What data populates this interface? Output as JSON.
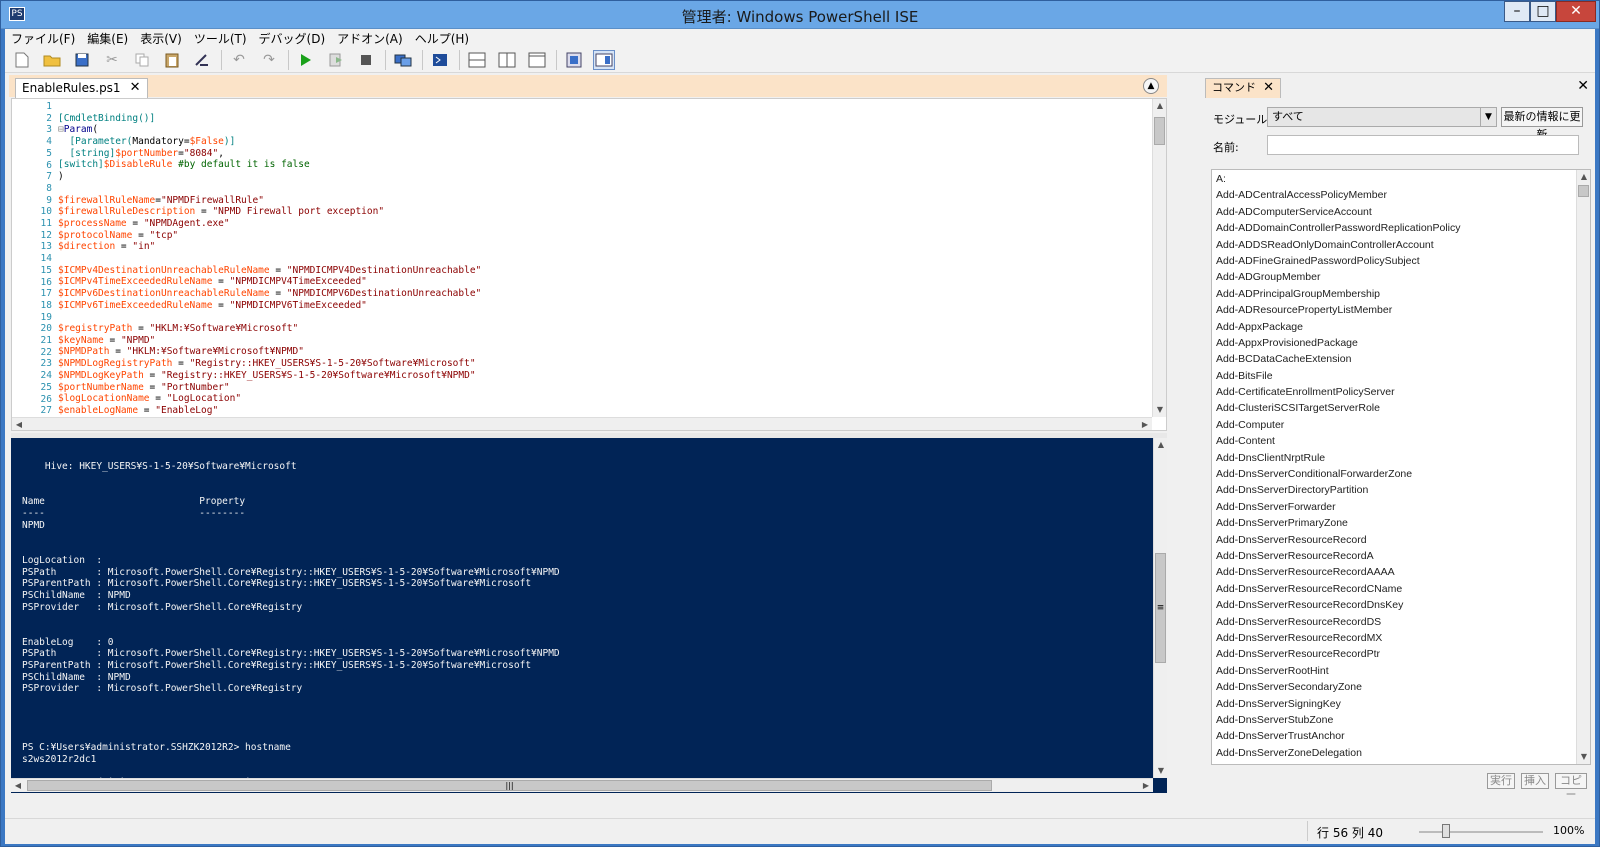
{
  "window": {
    "title": "管理者: Windows PowerShell ISE",
    "icon_glyph": "PS",
    "min": "–",
    "max": "□",
    "close": "✕"
  },
  "menus": [
    "ファイル(F)",
    "編集(E)",
    "表示(V)",
    "ツール(T)",
    "デバッグ(D)",
    "アドオン(A)",
    "ヘルプ(H)"
  ],
  "toolbar": {
    "icons": [
      "new-file-icon",
      "open-folder-icon",
      "save-icon",
      "cut-icon",
      "copy-icon",
      "paste-icon",
      "clear-icon",
      "undo-icon",
      "redo-icon",
      "run-icon",
      "run-selection-icon",
      "stop-icon",
      "remote-icon",
      "powershell-icon",
      "layout-top-icon",
      "layout-right-icon",
      "layout-max-icon",
      "show-commands-icon",
      "show-addon-icon"
    ],
    "colors": {
      "run": "#1aa11a",
      "stop": "#555555"
    }
  },
  "editor": {
    "tab": "EnableRules.ps1",
    "tab_close": "✕",
    "collapse_glyph": "▲",
    "lines": [
      [],
      [
        [
          "t",
          "[CmdletBinding()]"
        ]
      ],
      [
        [
          "fold",
          "⊟"
        ],
        [
          "k",
          "Param"
        ],
        [
          "",
          "("
        ]
      ],
      [
        [
          "",
          "  "
        ],
        [
          "t",
          "[Parameter("
        ],
        [
          "",
          "Mandatory="
        ],
        [
          "v",
          "$False"
        ],
        [
          "t",
          ")]"
        ]
      ],
      [
        [
          "",
          "  "
        ],
        [
          "t",
          "[string]"
        ],
        [
          "v",
          "$portNumber"
        ],
        [
          "",
          "="
        ],
        [
          "s",
          "\"8084\""
        ],
        [
          "",
          ","
        ]
      ],
      [
        [
          "t",
          "[switch]"
        ],
        [
          "v",
          "$DisableRule"
        ],
        [
          "",
          " "
        ],
        [
          "c",
          "#by default it is false"
        ]
      ],
      [
        [
          "",
          ")"
        ]
      ],
      [],
      [
        [
          "v",
          "$firewallRuleName"
        ],
        [
          "",
          "="
        ],
        [
          "s",
          "\"NPMDFirewallRule\""
        ]
      ],
      [
        [
          "v",
          "$firewallRuleDescription"
        ],
        [
          "",
          " = "
        ],
        [
          "s",
          "\"NPMD Firewall port exception\""
        ]
      ],
      [
        [
          "v",
          "$processName"
        ],
        [
          "",
          " = "
        ],
        [
          "s",
          "\"NPMDAgent.exe\""
        ]
      ],
      [
        [
          "v",
          "$protocolName"
        ],
        [
          "",
          " = "
        ],
        [
          "s",
          "\"tcp\""
        ]
      ],
      [
        [
          "v",
          "$direction"
        ],
        [
          "",
          " = "
        ],
        [
          "s",
          "\"in\""
        ]
      ],
      [],
      [
        [
          "v",
          "$ICMPv4DestinationUnreachableRuleName"
        ],
        [
          "",
          " = "
        ],
        [
          "s",
          "\"NPMDICMPV4DestinationUnreachable\""
        ]
      ],
      [
        [
          "v",
          "$ICMPv4TimeExceededRuleName"
        ],
        [
          "",
          " = "
        ],
        [
          "s",
          "\"NPMDICMPV4TimeExceeded\""
        ]
      ],
      [
        [
          "v",
          "$ICMPv6DestinationUnreachableRuleName"
        ],
        [
          "",
          " = "
        ],
        [
          "s",
          "\"NPMDICMPV6DestinationUnreachable\""
        ]
      ],
      [
        [
          "v",
          "$ICMPv6TimeExceededRuleName"
        ],
        [
          "",
          " = "
        ],
        [
          "s",
          "\"NPMDICMPV6TimeExceeded\""
        ]
      ],
      [],
      [
        [
          "v",
          "$registryPath"
        ],
        [
          "",
          " = "
        ],
        [
          "s",
          "\"HKLM:¥Software¥Microsoft\""
        ]
      ],
      [
        [
          "v",
          "$keyName"
        ],
        [
          "",
          " = "
        ],
        [
          "s",
          "\"NPMD\""
        ]
      ],
      [
        [
          "v",
          "$NPMDPath"
        ],
        [
          "",
          " = "
        ],
        [
          "s",
          "\"HKLM:¥Software¥Microsoft¥NPMD\""
        ]
      ],
      [
        [
          "v",
          "$NPMDLogRegistryPath"
        ],
        [
          "",
          " = "
        ],
        [
          "s",
          "\"Registry::HKEY_USERS¥S-1-5-20¥Software¥Microsoft\""
        ]
      ],
      [
        [
          "v",
          "$NPMDLogKeyPath"
        ],
        [
          "",
          " = "
        ],
        [
          "s",
          "\"Registry::HKEY_USERS¥S-1-5-20¥Software¥Microsoft¥NPMD\""
        ]
      ],
      [
        [
          "v",
          "$portNumberName"
        ],
        [
          "",
          " = "
        ],
        [
          "s",
          "\"PortNumber\""
        ]
      ],
      [
        [
          "v",
          "$logLocationName"
        ],
        [
          "",
          " = "
        ],
        [
          "s",
          "\"LogLocation\""
        ]
      ],
      [
        [
          "v",
          "$enableLogName"
        ],
        [
          "",
          " = "
        ],
        [
          "s",
          "\"EnableLog\""
        ]
      ]
    ]
  },
  "console": {
    "lines": [
      "",
      "",
      "    Hive: HKEY_USERS¥S-1-5-20¥Software¥Microsoft",
      "",
      "",
      "Name                           Property",
      "----                           --------",
      "NPMD",
      "",
      "",
      "LogLocation  :",
      "PSPath       : Microsoft.PowerShell.Core¥Registry::HKEY_USERS¥S-1-5-20¥Software¥Microsoft¥NPMD",
      "PSParentPath : Microsoft.PowerShell.Core¥Registry::HKEY_USERS¥S-1-5-20¥Software¥Microsoft",
      "PSChildName  : NPMD",
      "PSProvider   : Microsoft.PowerShell.Core¥Registry",
      "",
      "",
      "EnableLog    : 0",
      "PSPath       : Microsoft.PowerShell.Core¥Registry::HKEY_USERS¥S-1-5-20¥Software¥Microsoft¥NPMD",
      "PSParentPath : Microsoft.PowerShell.Core¥Registry::HKEY_USERS¥S-1-5-20¥Software¥Microsoft",
      "PSChildName  : NPMD",
      "PSProvider   : Microsoft.PowerShell.Core¥Registry",
      "",
      "",
      "",
      "",
      "PS C:¥Users¥administrator.SSHZK2012R2> hostname",
      "s2ws2012r2dc1",
      "",
      "PS C:¥Users¥administrator.SSHZK2012R2> |"
    ]
  },
  "commands": {
    "tab": "コマンド",
    "tab_close": "✕",
    "pane_close": "✕",
    "module_label": "モジュール:",
    "module_value": "すべて",
    "refresh_button": "最新の情報に更新",
    "name_label": "名前:",
    "name_value": "",
    "items": [
      "A:",
      "Add-ADCentralAccessPolicyMember",
      "Add-ADComputerServiceAccount",
      "Add-ADDomainControllerPasswordReplicationPolicy",
      "Add-ADDSReadOnlyDomainControllerAccount",
      "Add-ADFineGrainedPasswordPolicySubject",
      "Add-ADGroupMember",
      "Add-ADPrincipalGroupMembership",
      "Add-ADResourcePropertyListMember",
      "Add-AppxPackage",
      "Add-AppxProvisionedPackage",
      "Add-BCDataCacheExtension",
      "Add-BitsFile",
      "Add-CertificateEnrollmentPolicyServer",
      "Add-ClusteriSCSITargetServerRole",
      "Add-Computer",
      "Add-Content",
      "Add-DnsClientNrptRule",
      "Add-DnsServerConditionalForwarderZone",
      "Add-DnsServerDirectoryPartition",
      "Add-DnsServerForwarder",
      "Add-DnsServerPrimaryZone",
      "Add-DnsServerResourceRecord",
      "Add-DnsServerResourceRecordA",
      "Add-DnsServerResourceRecordAAAA",
      "Add-DnsServerResourceRecordCName",
      "Add-DnsServerResourceRecordDnsKey",
      "Add-DnsServerResourceRecordDS",
      "Add-DnsServerResourceRecordMX",
      "Add-DnsServerResourceRecordPtr",
      "Add-DnsServerRootHint",
      "Add-DnsServerSecondaryZone",
      "Add-DnsServerSigningKey",
      "Add-DnsServerStubZone",
      "Add-DnsServerTrustAnchor",
      "Add-DnsServerZoneDelegation"
    ],
    "run_button": "実行",
    "insert_button": "挿入",
    "copy_button": "コピー"
  },
  "status": {
    "position": "行 56 列 40",
    "zoom": "100%",
    "zoom_level": 0.22
  },
  "scroll_glyphs": {
    "up": "▲",
    "down": "▼",
    "left": "◀",
    "right": "▶",
    "grip": "≡",
    "hgrip": "|||"
  }
}
